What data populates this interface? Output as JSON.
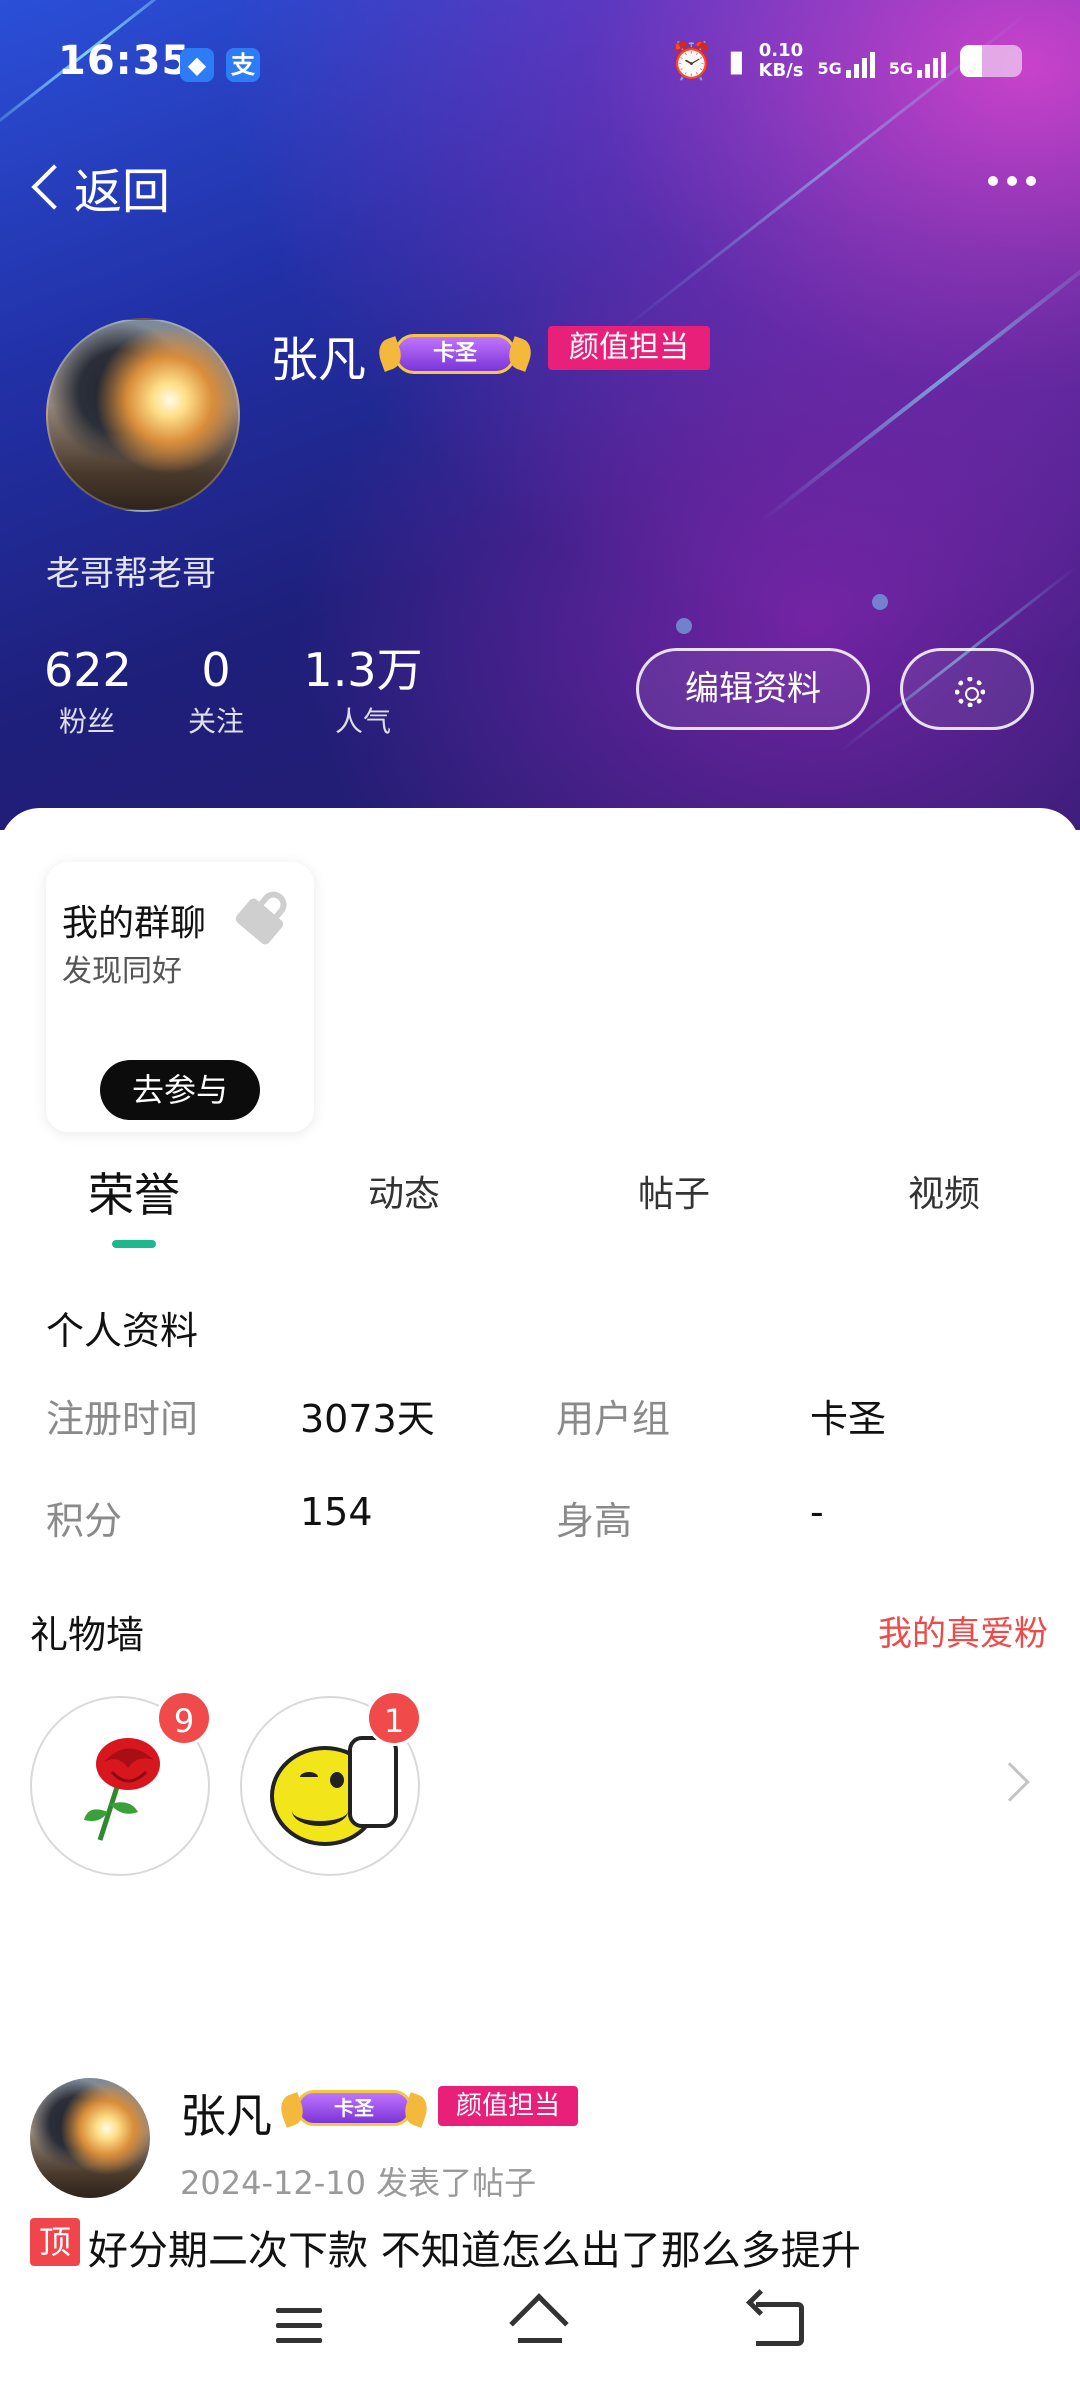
{
  "status_bar": {
    "time": "16:35",
    "net_speed_value": "0.10",
    "net_speed_unit": "KB/s",
    "sim1": "5G",
    "sim2": "5G",
    "app_icon_alipay": "支"
  },
  "header": {
    "back_label": "返回"
  },
  "profile": {
    "name": "张凡",
    "level_badge": "卡圣",
    "title_tag": "颜值担当",
    "bio": "老哥帮老哥",
    "stats": [
      {
        "value": "622",
        "label": "粉丝"
      },
      {
        "value": "0",
        "label": "关注"
      },
      {
        "value": "1.3万",
        "label": "人气"
      }
    ],
    "edit_button": "编辑资料"
  },
  "group_card": {
    "title": "我的群聊",
    "subtitle": "发现同好",
    "button": "去参与"
  },
  "tabs": [
    "荣誉",
    "动态",
    "帖子",
    "视频"
  ],
  "personal_info": {
    "title": "个人资料",
    "rows": [
      {
        "k1": "注册时间",
        "v1": "3073天",
        "k2": "用户组",
        "v2": "卡圣"
      },
      {
        "k1": "积分",
        "v1": "154",
        "k2": "身高",
        "v2": "-"
      }
    ]
  },
  "gift_wall": {
    "title": "礼物墙",
    "link": "我的真爱粉",
    "gifts": [
      {
        "icon": "rose-icon",
        "count": "9"
      },
      {
        "icon": "thumbs-up-smiley-icon",
        "count": "1"
      }
    ]
  },
  "post": {
    "author": "张凡",
    "level_badge": "卡圣",
    "title_tag": "颜值担当",
    "meta": "2024-12-10  发表了帖子",
    "pin_label": "顶",
    "text": "好分期二次下款 不知道怎么出了那么多提升"
  },
  "colors": {
    "accent_green": "#1db88e",
    "tag_pink": "#e9207a",
    "link_red": "#ef4a4a",
    "badge_red": "#f14a4a"
  }
}
